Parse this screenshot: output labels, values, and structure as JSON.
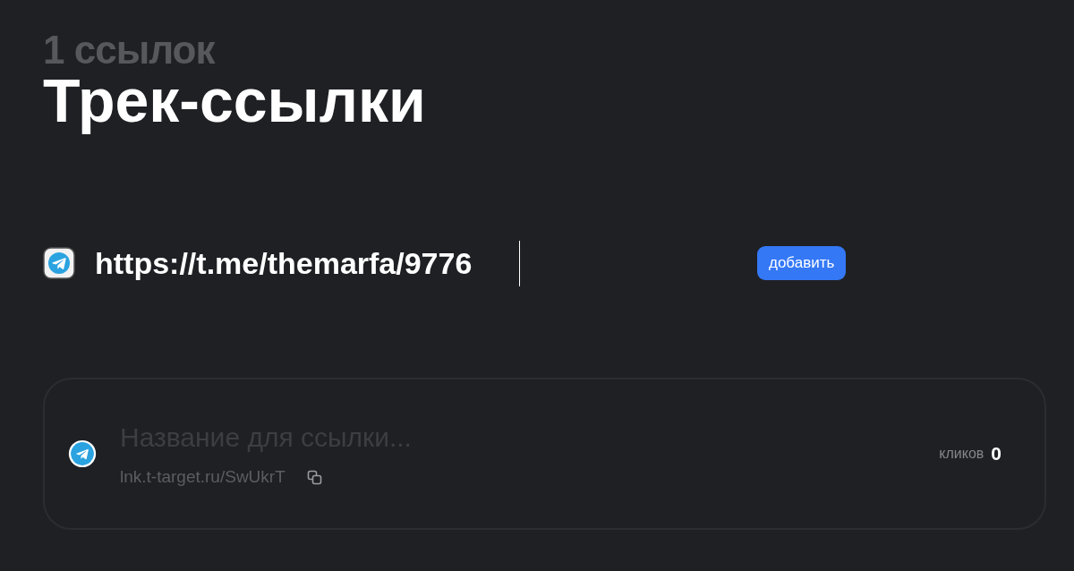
{
  "count_label": "1 ссылок",
  "title": "Трек-ссылки",
  "new_link": {
    "value": "https://t.me/themarfa/9776",
    "button": "добавить"
  },
  "links": [
    {
      "name_placeholder": "Название для ссылки...",
      "short_url": "lnk.t-target.ru/SwUkrT",
      "clicks_label": "кликов",
      "clicks": "0"
    }
  ]
}
